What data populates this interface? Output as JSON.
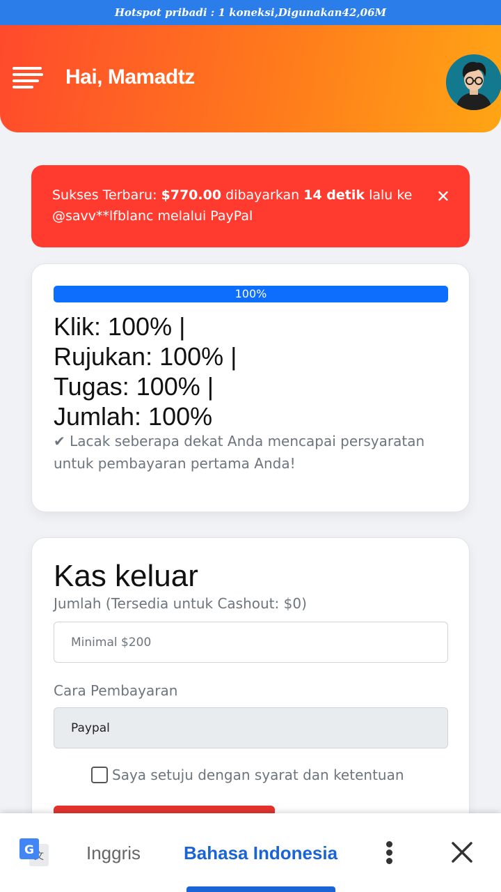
{
  "status_bar": {
    "text": "Hotspot pribadi : 1 koneksi,Digunakan42,06M"
  },
  "header": {
    "greeting": "Hai, Mamadtz"
  },
  "alert": {
    "prefix": "Sukses Terbaru: ",
    "amount": "$770.00",
    "mid": " dibayarkan ",
    "time": "14 detik",
    "suffix": " lalu ke @savv**lfblanc melalui PayPal",
    "close": "✕"
  },
  "progress": {
    "label": "100%",
    "fraction": 1.0,
    "lines": [
      "Klik: 100% |",
      "Rujukan: 100% |",
      "Tugas: 100% |",
      "Jumlah: 100%"
    ],
    "note": "Lacak seberapa dekat Anda mencapai persyaratan untuk pembayaran pertama Anda!"
  },
  "cashout": {
    "title": "Kas keluar",
    "amount_label": "Jumlah (Tersedia untuk Cashout: $0)",
    "amount_placeholder": "Minimal $200",
    "method_label": "Cara Pembayaran",
    "method_value": "Paypal",
    "agree_text": "Saya setuju dengan syarat dan ketentuan"
  },
  "translate_bar": {
    "source_lang": "Inggris",
    "target_lang": "Bahasa Indonesia"
  },
  "colors": {
    "accent_blue": "#0d6efd",
    "alert_red": "#ff3b30",
    "header_start": "#ff4a2c",
    "header_end": "#ffa514"
  }
}
